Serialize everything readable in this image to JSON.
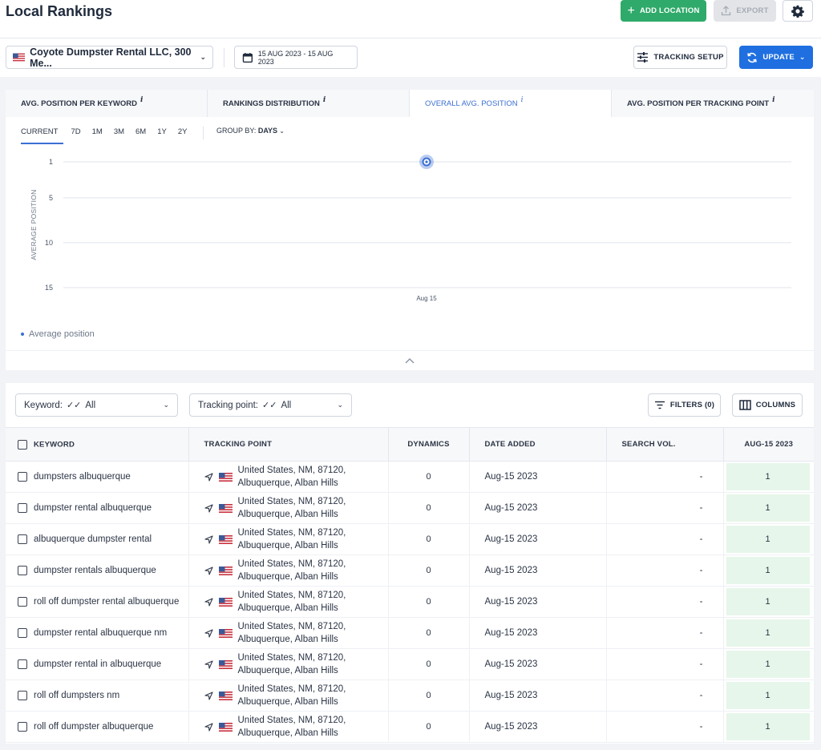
{
  "header": {
    "title": "Local Rankings",
    "add_location_label": "ADD LOCATION",
    "export_label": "EXPORT",
    "settings_icon": "gear-icon"
  },
  "toolbar": {
    "project": "Coyote Dumpster Rental LLC, 300 Me...",
    "date_range": "15 AUG 2023 - 15 AUG 2023",
    "tracking_setup_label": "TRACKING SETUP",
    "update_label": "UPDATE"
  },
  "chart_card": {
    "tabs": [
      {
        "label": "AVG. POSITION PER KEYWORD",
        "active": false
      },
      {
        "label": "RANKINGS DISTRIBUTION",
        "active": false
      },
      {
        "label": "OVERALL AVG. POSITION",
        "active": true
      },
      {
        "label": "AVG. POSITION PER TRACKING POINT",
        "active": false
      }
    ],
    "info_glyph": "i",
    "ranges": [
      "CURRENT",
      "7D",
      "1M",
      "3M",
      "6M",
      "1Y",
      "2Y"
    ],
    "active_range": "CURRENT",
    "group_by_label": "GROUP BY:",
    "group_by_value": "DAYS"
  },
  "chart_data": {
    "type": "line",
    "x": [
      "Aug 15"
    ],
    "series": [
      {
        "name": "Average position",
        "values": [
          1
        ]
      }
    ],
    "ylabel": "AVERAGE POSITION",
    "xlabel": "",
    "yticks": [
      1,
      5,
      10,
      15
    ],
    "ylim": [
      1,
      15
    ],
    "y_inverted": true,
    "grid": true,
    "legend": "bottom-left",
    "color": "#3b6fd4"
  },
  "filters": {
    "keyword_label": "Keyword:",
    "keyword_value": "All",
    "tracking_point_label": "Tracking point:",
    "tracking_point_value": "All",
    "filters_label": "FILTERS (0)",
    "columns_label": "COLUMNS"
  },
  "table": {
    "headers": {
      "keyword": "KEYWORD",
      "tracking_point": "TRACKING POINT",
      "dynamics": "DYNAMICS",
      "date_added": "DATE ADDED",
      "search_vol": "SEARCH VOL.",
      "date_col": "AUG-15 2023"
    },
    "rows": [
      {
        "keyword": "dumpsters albuquerque",
        "tp_line1": "United States, NM, 87120,",
        "tp_line2": "Albuquerque, Alban Hills",
        "dynamics": "0",
        "date_added": "Aug-15 2023",
        "search_vol": "-",
        "position": "1"
      },
      {
        "keyword": "dumpster rental albuquerque",
        "tp_line1": "United States, NM, 87120,",
        "tp_line2": "Albuquerque, Alban Hills",
        "dynamics": "0",
        "date_added": "Aug-15 2023",
        "search_vol": "-",
        "position": "1"
      },
      {
        "keyword": "albuquerque dumpster rental",
        "tp_line1": "United States, NM, 87120,",
        "tp_line2": "Albuquerque, Alban Hills",
        "dynamics": "0",
        "date_added": "Aug-15 2023",
        "search_vol": "-",
        "position": "1"
      },
      {
        "keyword": "dumpster rentals albuquerque",
        "tp_line1": "United States, NM, 87120,",
        "tp_line2": "Albuquerque, Alban Hills",
        "dynamics": "0",
        "date_added": "Aug-15 2023",
        "search_vol": "-",
        "position": "1"
      },
      {
        "keyword": "roll off dumpster rental albuquerque",
        "tp_line1": "United States, NM, 87120,",
        "tp_line2": "Albuquerque, Alban Hills",
        "dynamics": "0",
        "date_added": "Aug-15 2023",
        "search_vol": "-",
        "position": "1"
      },
      {
        "keyword": "dumpster rental albuquerque nm",
        "tp_line1": "United States, NM, 87120,",
        "tp_line2": "Albuquerque, Alban Hills",
        "dynamics": "0",
        "date_added": "Aug-15 2023",
        "search_vol": "-",
        "position": "1"
      },
      {
        "keyword": "dumpster rental in albuquerque",
        "tp_line1": "United States, NM, 87120,",
        "tp_line2": "Albuquerque, Alban Hills",
        "dynamics": "0",
        "date_added": "Aug-15 2023",
        "search_vol": "-",
        "position": "1"
      },
      {
        "keyword": "roll off dumpsters nm",
        "tp_line1": "United States, NM, 87120,",
        "tp_line2": "Albuquerque, Alban Hills",
        "dynamics": "0",
        "date_added": "Aug-15 2023",
        "search_vol": "-",
        "position": "1"
      },
      {
        "keyword": "roll off dumpster albuquerque",
        "tp_line1": "United States, NM, 87120,",
        "tp_line2": "Albuquerque, Alban Hills",
        "dynamics": "0",
        "date_added": "Aug-15 2023",
        "search_vol": "-",
        "position": "1"
      }
    ]
  },
  "colors": {
    "accent": "#3b6fd4",
    "add_button": "#2faa6a",
    "update_button": "#1f6fe0",
    "position_cell": "#e6f6ea"
  }
}
